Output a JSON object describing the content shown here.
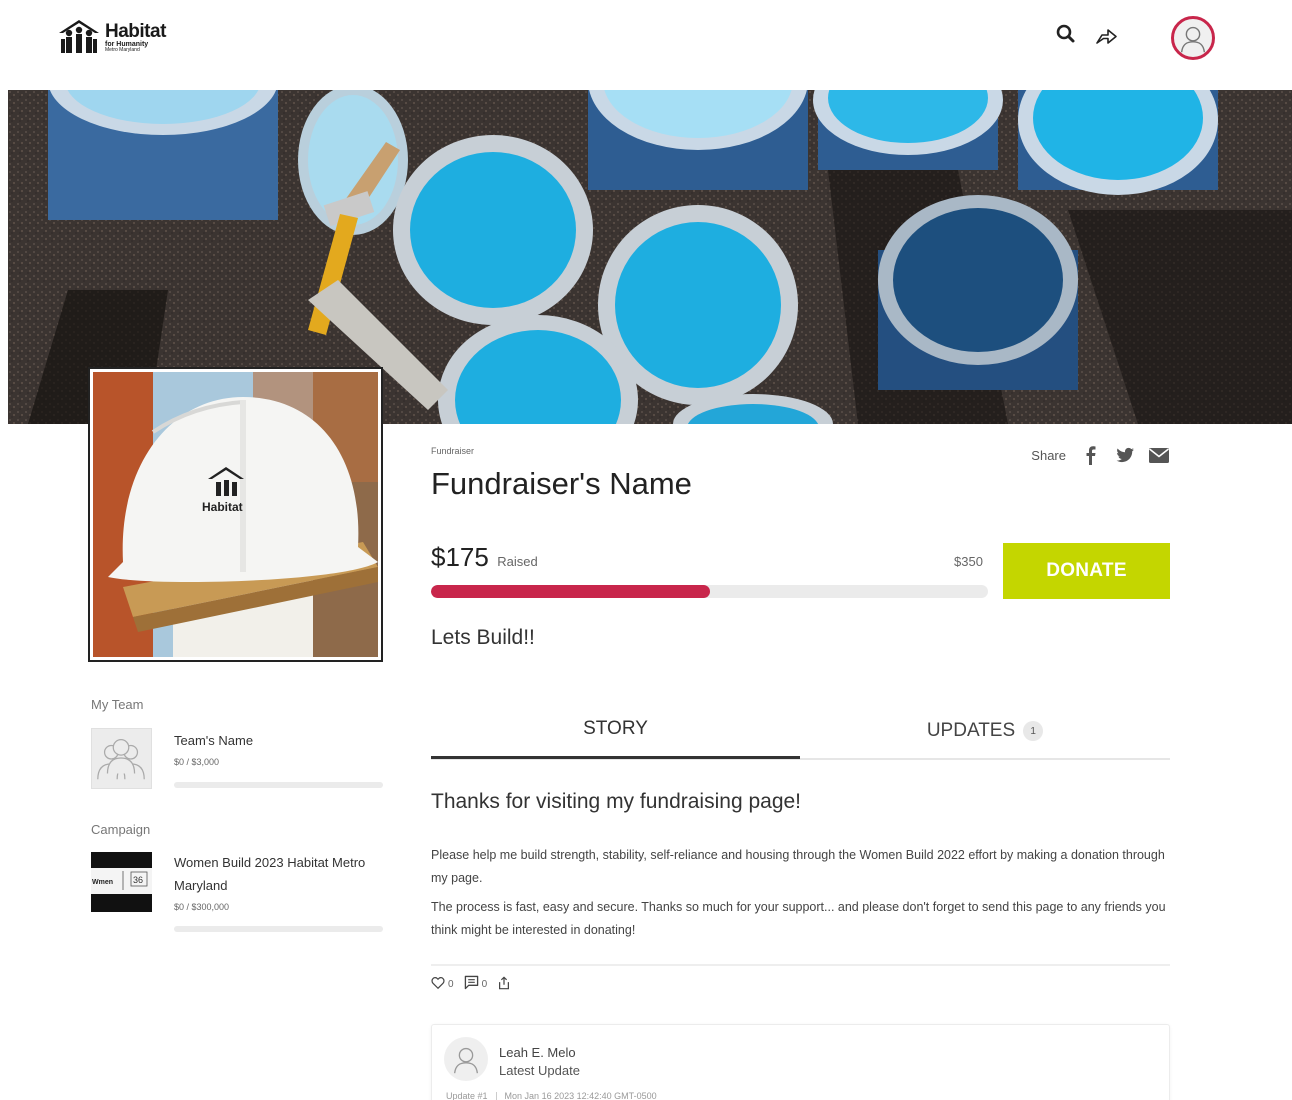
{
  "header": {
    "logo": {
      "line1": "Habitat",
      "line2": "for Humanity",
      "line3": "Metro Maryland"
    },
    "icons": [
      "search-icon",
      "share-icon",
      "user-avatar"
    ]
  },
  "fundraiser": {
    "kicker": "Fundraiser",
    "name": "Fundraiser's Name",
    "share_label": "Share",
    "raised_amount": "$175",
    "raised_label": "Raised",
    "goal_amount": "$350",
    "progress_fraction": 0.5,
    "donate_label": "DONATE",
    "tagline": "Lets Build!!"
  },
  "tabs": {
    "story_label": "STORY",
    "updates_label": "UPDATES",
    "updates_count": "1"
  },
  "story": {
    "title": "Thanks for visiting my fundraising page!",
    "paragraph1": "Please help me build strength, stability, self-reliance and housing through the Women Build 2022 effort by making a donation through my page.",
    "paragraph2": "The process is fast, easy and secure. Thanks so much for your support... and please don't forget to send this page to any friends you think might be interested in donating!",
    "likes_count": "0",
    "comments_count": "0"
  },
  "latest_update": {
    "author": "Leah E. Melo",
    "subtitle": "Latest Update",
    "update_number": "Update #1",
    "timestamp": "Mon Jan 16 2023 12:42:40 GMT-0500"
  },
  "sidebar": {
    "team_label": "My Team",
    "team_name": "Team's Name",
    "team_amount": "$0 / $3,000",
    "team_progress_fraction": 0,
    "campaign_label": "Campaign",
    "campaign_name": "Women Build 2023 Habitat Metro Maryland",
    "campaign_amount": "$0 / $300,000",
    "campaign_progress_fraction": 0
  },
  "colors": {
    "accent_red": "#c8264b",
    "donate_green": "#c4d600",
    "paint_blue": "#1eaee0"
  }
}
